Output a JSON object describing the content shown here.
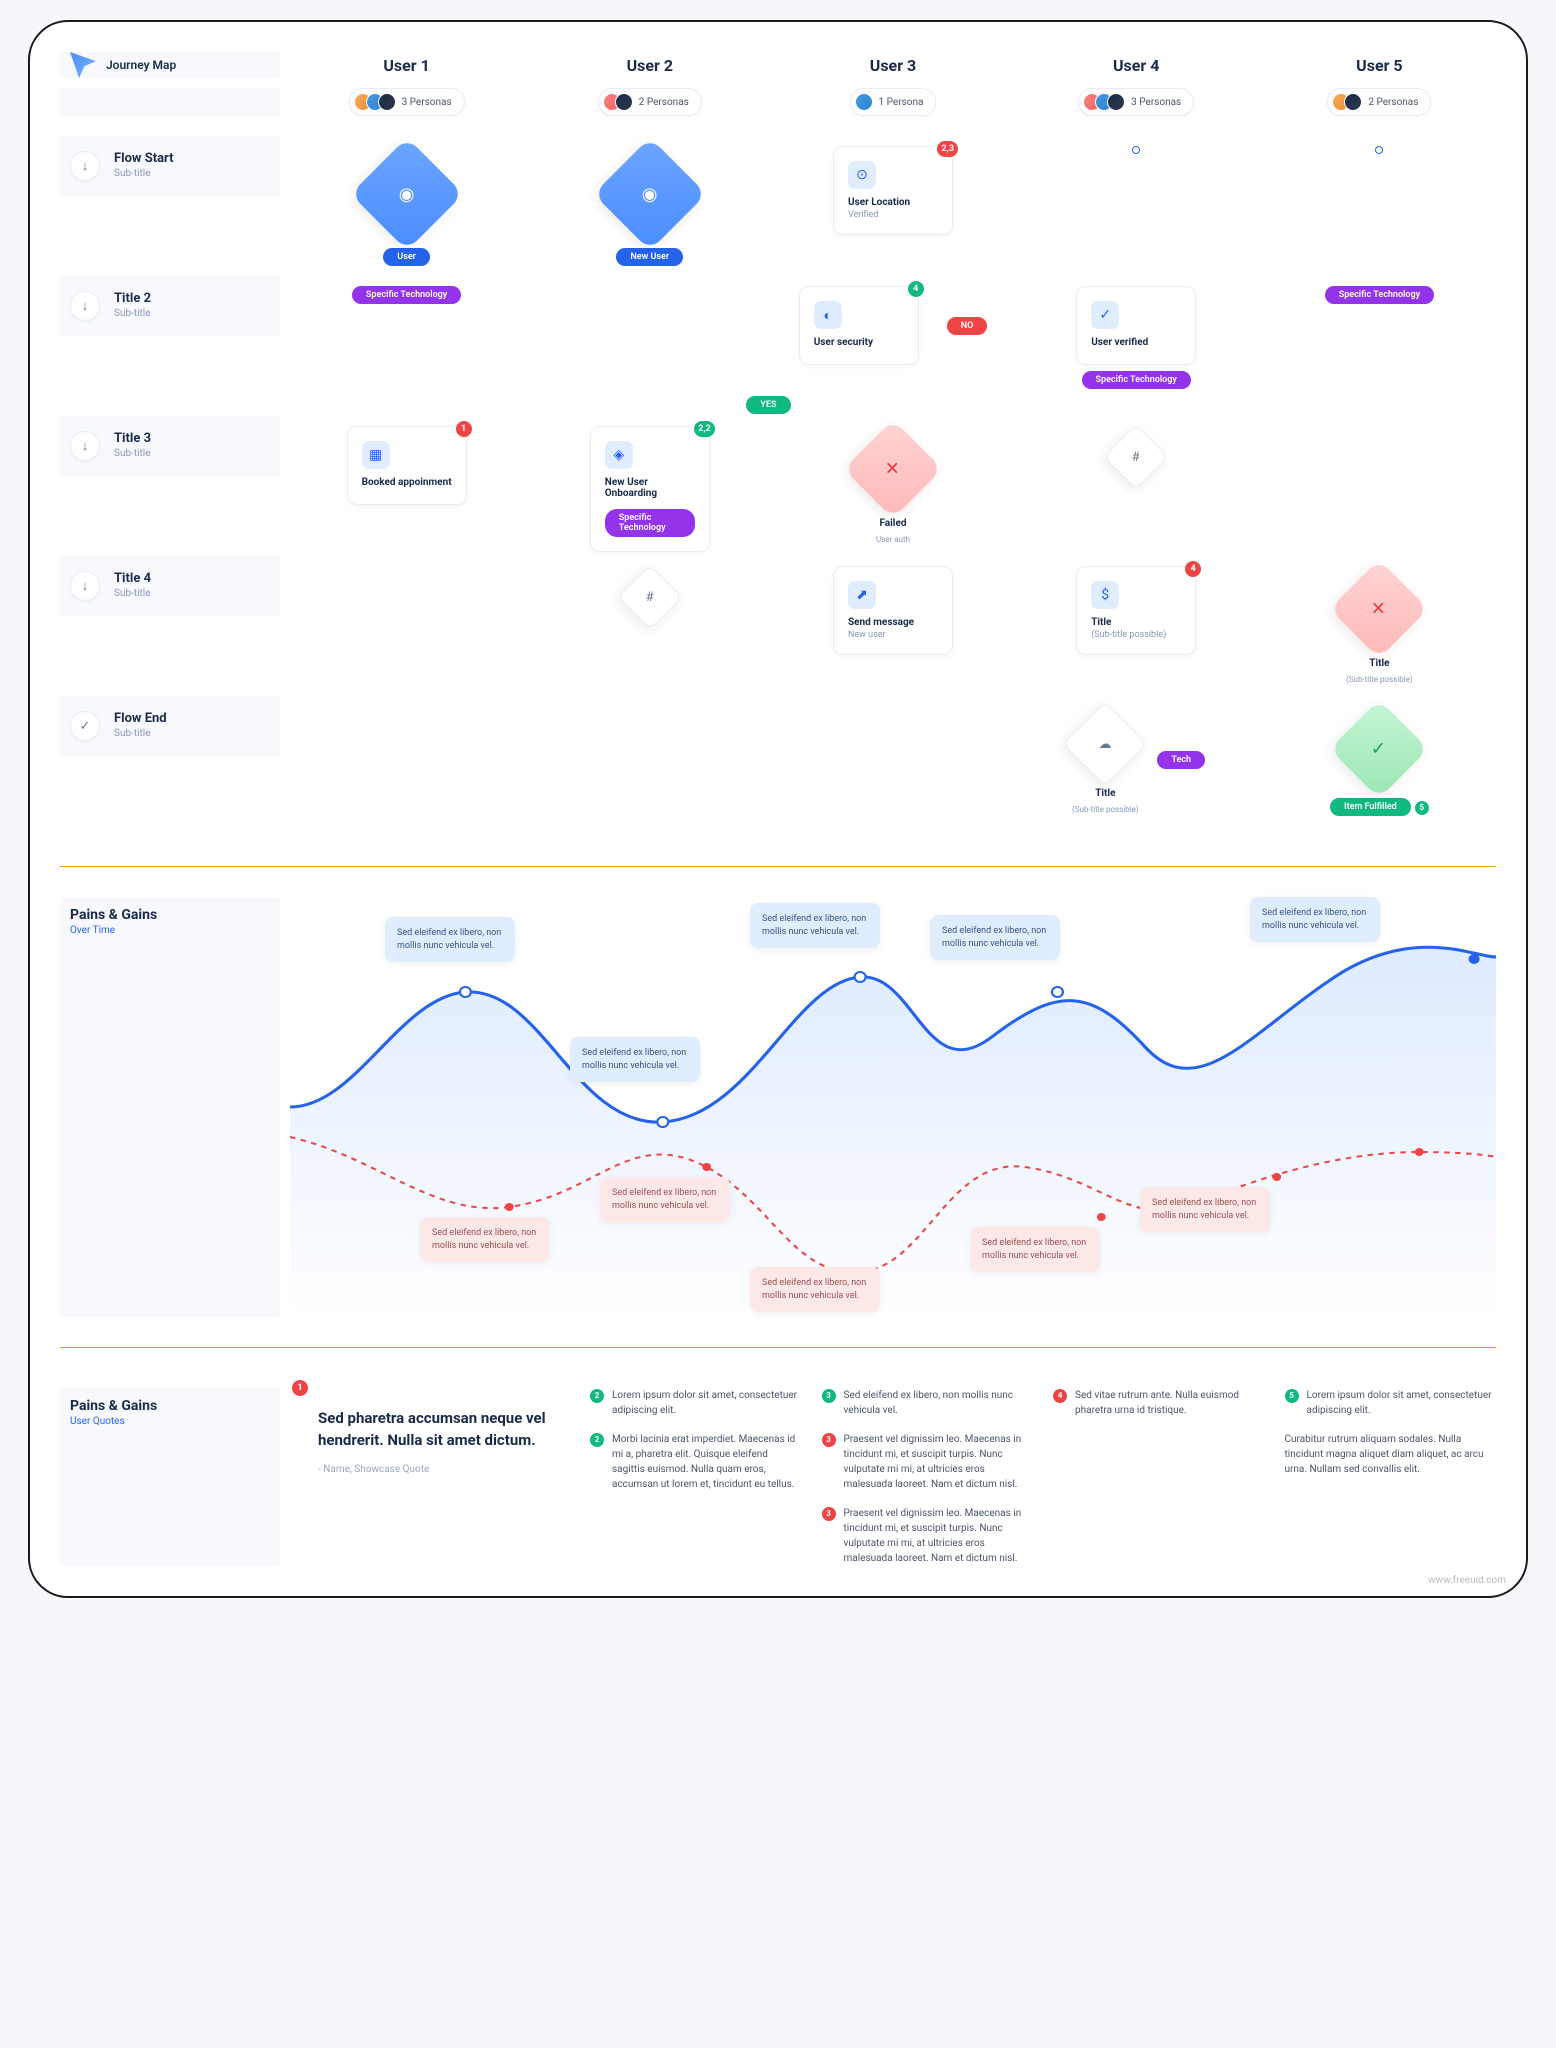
{
  "logo": {
    "text": "Journey Map"
  },
  "users": [
    "User 1",
    "User 2",
    "User 3",
    "User 4",
    "User 5"
  ],
  "personas": [
    {
      "count": "3 Personas",
      "av": 3
    },
    {
      "count": "2 Personas",
      "av": 2
    },
    {
      "count": "1 Persona",
      "av": 1
    },
    {
      "count": "3 Personas",
      "av": 3
    },
    {
      "count": "2 Personas",
      "av": 2
    }
  ],
  "stages": [
    {
      "icon": "↓",
      "title": "Flow Start",
      "sub": "Sub-title"
    },
    {
      "icon": "↓",
      "title": "Title 2",
      "sub": "Sub-title"
    },
    {
      "icon": "↓",
      "title": "Title 3",
      "sub": "Sub-title"
    },
    {
      "icon": "↓",
      "title": "Title 4",
      "sub": "Sub-title"
    },
    {
      "icon": "✓",
      "title": "Flow End",
      "sub": "Sub-title"
    }
  ],
  "nodes": {
    "user_pill": "User",
    "new_user_pill": "New User",
    "spec_tech": "Specific Technology",
    "booked": "Booked appoinment",
    "onboarding": "New User Onboarding",
    "loc_title": "User Location",
    "loc_sub": "Verified",
    "sec_title": "User security",
    "failed": "Failed",
    "failed_sub": "User auth",
    "send_msg": "Send message",
    "send_sub": "New user",
    "verified": "User verified",
    "title_generic": "Title",
    "sub_generic": "(Sub-title possible)",
    "tech": "Tech",
    "fulfilled": "Item Fulfilled",
    "yes": "YES",
    "no": "NO",
    "hash": "#",
    "b1": "1",
    "b22": "2,2",
    "b23": "2,3",
    "b4": "4",
    "b5": "5"
  },
  "pains": {
    "title": "Pains & Gains",
    "sub": "Over Time",
    "tooltip": "Sed eleifend ex libero, non mollis nunc vehicula vel."
  },
  "quotes": {
    "title": "Pains & Gains",
    "sub": "User Quotes",
    "big": "Sed pharetra accumsan neque vel hendrerit. Nulla sit amet dictum.",
    "author": "- Name, Showcase Quote",
    "items": {
      "c1a": "Lorem ipsum dolor sit amet, consectetuer adipiscing elit.",
      "c1b": "Morbi lacinia erat imperdiet. Maecenas id mi a, pharetra elit. Quisque eleifend sagittis euismod. Nulla quam eros, accumsan ut lorem et, tincidunt eu tellus.",
      "c2a": "Sed eleifend ex libero, non mollis nunc vehicula vel.",
      "c2b": "Praesent vel dignissim leo. Maecenas in tincidunt mi, et suscipit turpis. Nunc vulputate mi mi, at ultricies eros malesuada laoreet. Nam et dictum nisl.",
      "c2c": "Praesent vel dignissim leo. Maecenas in tincidunt mi, et suscipit turpis. Nunc vulputate mi mi, at ultricies eros malesuada laoreet. Nam et dictum nisl.",
      "c3a": "Sed vitae rutrum ante. Nulla euismod pharetra urna id tristique.",
      "c4a": "Lorem ipsum dolor sit amet, consectetuer adipiscing elit.",
      "c4b": "Curabitur rutrum aliquam sodales. Nulla tincidunt magna aliquet diam aliquet, ac arcu urna. Nullam sed convallis elit."
    }
  },
  "watermark": "www.freeuid.com"
}
